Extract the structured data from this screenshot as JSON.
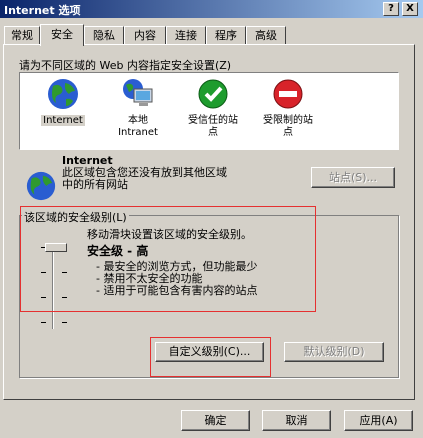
{
  "window": {
    "title": "Internet 选项",
    "help_button": "?",
    "close_button": "X"
  },
  "tabs": [
    {
      "label": "常规"
    },
    {
      "label": "安全"
    },
    {
      "label": "隐私"
    },
    {
      "label": "内容"
    },
    {
      "label": "连接"
    },
    {
      "label": "程序"
    },
    {
      "label": "高级"
    }
  ],
  "active_tab": "安全",
  "zones": {
    "prompt": "请为不同区域的 Web 内容指定安全设置(Z)",
    "items": [
      {
        "label": "Internet",
        "icon": "globe-icon"
      },
      {
        "label": "本地\nIntranet",
        "icon": "computer-globe-icon"
      },
      {
        "label": "受信任的站\n点",
        "icon": "green-check-icon"
      },
      {
        "label": "受限制的站\n点",
        "icon": "red-no-entry-icon"
      }
    ],
    "selected": "Internet"
  },
  "zone_info": {
    "title": "Internet",
    "description": "此区域包含您还没有放到其他区域\n中的所有网站",
    "sites_button": "站点(S)..."
  },
  "security_level": {
    "group_label": "该区域的安全级别(L)",
    "hint": "移动滑块设置该区域的安全级别。",
    "level_name": "安全级 - 高",
    "bullets": [
      "- 最安全的浏览方式，但功能最少",
      "- 禁用不太安全的功能",
      "- 适用于可能包含有害内容的站点"
    ],
    "custom_button": "自定义级别(C)...",
    "default_button": "默认级别(D)",
    "slider_position": "top"
  },
  "footer": {
    "ok": "确定",
    "cancel": "取消",
    "apply": "应用(A)"
  },
  "colors": {
    "dialog": "#d4d0c8",
    "title_start": "#0a246a",
    "title_end": "#a6caf0",
    "highlight": "#e53030"
  }
}
